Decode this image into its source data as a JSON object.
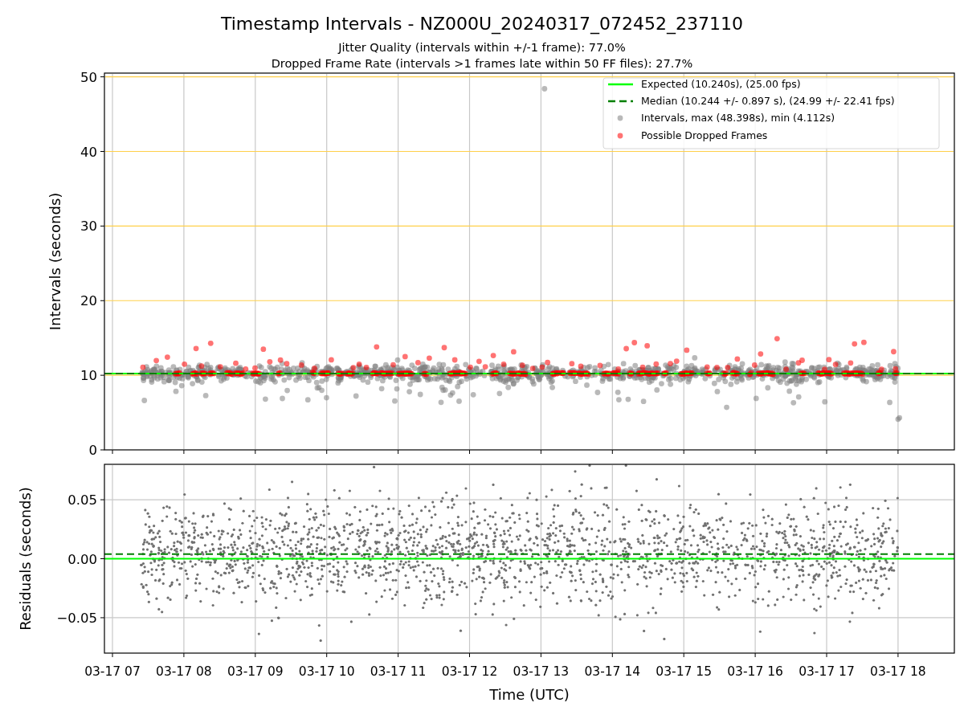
{
  "figure": {
    "title": "Timestamp Intervals - NZ000U_20240317_072452_237110",
    "subtitles": [
      "Jitter Quality (intervals within +/-1 frame): 77.0%",
      "Dropped Frame Rate (intervals >1 frames late within 50 FF files): 27.7%"
    ]
  },
  "charts": [
    {
      "chart_data": {
        "type": "scatter",
        "ylabel": "Intervals (seconds)",
        "ylim": [
          0,
          50.5
        ],
        "grid": true,
        "yticks": [
          {
            "value": 0,
            "label": "0"
          },
          {
            "value": 10,
            "label": "10"
          },
          {
            "value": 20,
            "label": "20"
          },
          {
            "value": 30,
            "label": "30"
          },
          {
            "value": 40,
            "label": "40"
          },
          {
            "value": 50,
            "label": "50"
          }
        ],
        "ref_lines": [
          {
            "axis": "y",
            "value": 10.24,
            "color": "#00ff00",
            "label": "Expected (10.240s), (25.00 fps)"
          },
          {
            "axis": "y",
            "value": 10.24,
            "color": "#007f00",
            "label": "Median (10.244 +/- 0.897 s), (24.99 +/- 22.41 fps)"
          }
        ],
        "legend": "upper right",
        "series": [
          {
            "name": "Intervals, max (48.398s), min (4.112s)",
            "color": "#808080",
            "values": [
              null
            ]
          },
          {
            "name": "Possible Dropped Frames",
            "color": "#ff0000",
            "values": [
              null
            ]
          }
        ]
      }
    },
    {
      "chart_data": {
        "type": "scatter",
        "xlabel": "Time (UTC)",
        "ylabel": "Residuals (seconds)",
        "ylim": [
          -0.08,
          0.08
        ],
        "grid": true,
        "yticks": [
          {
            "value": -0.05,
            "label": "−0.05"
          },
          {
            "value": 0,
            "label": "0.00"
          },
          {
            "value": 0.05,
            "label": "0.05"
          }
        ],
        "categories": [
          "03-17 07",
          "03-17 08",
          "03-17 09",
          "03-17 10",
          "03-17 11",
          "03-17 12",
          "03-17 13",
          "03-17 14",
          "03-17 15",
          "03-17 16",
          "03-17 17",
          "03-17 18"
        ],
        "ref_lines": [
          {
            "axis": "y",
            "value": 0,
            "color": "#00ff00"
          },
          {
            "axis": "y",
            "value": 0.004,
            "color": "#007f00"
          }
        ]
      }
    }
  ]
}
